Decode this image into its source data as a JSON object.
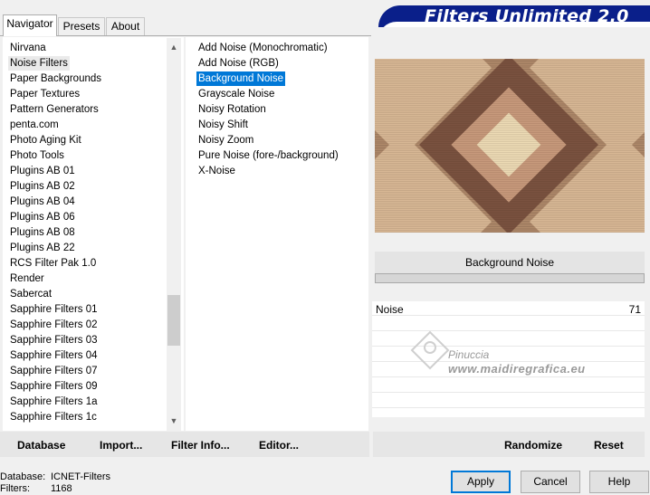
{
  "window": {
    "banner_title": "Filters Unlimited 2.0"
  },
  "tabs": [
    {
      "label": "Navigator",
      "active": true
    },
    {
      "label": "Presets",
      "active": false
    },
    {
      "label": "About",
      "active": false
    }
  ],
  "categories": [
    "Nirvana",
    "Noise Filters",
    "Paper Backgrounds",
    "Paper Textures",
    "Pattern Generators",
    "penta.com",
    "Photo Aging Kit",
    "Photo Tools",
    "Plugins AB 01",
    "Plugins AB 02",
    "Plugins AB 04",
    "Plugins AB 06",
    "Plugins AB 08",
    "Plugins AB 22",
    "RCS Filter Pak 1.0",
    "Render",
    "Sabercat",
    "Sapphire Filters 01",
    "Sapphire Filters 02",
    "Sapphire Filters 03",
    "Sapphire Filters 04",
    "Sapphire Filters 07",
    "Sapphire Filters 09",
    "Sapphire Filters 1a",
    "Sapphire Filters 1c"
  ],
  "selected_category": "Noise Filters",
  "filters": [
    "Add Noise (Monochromatic)",
    "Add Noise (RGB)",
    "Background Noise",
    "Grayscale Noise",
    "Noisy Rotation",
    "Noisy Shift",
    "Noisy Zoom",
    "Pure Noise (fore-/background)",
    "X-Noise"
  ],
  "selected_filter": "Background Noise",
  "preview": {
    "filter_name": "Background Noise"
  },
  "parameters": [
    {
      "label": "Noise",
      "value": "71"
    }
  ],
  "watermark": {
    "line1": "Pinuccia",
    "line2": "www.maidiregrafica.eu"
  },
  "actions": {
    "database": "Database",
    "import": "Import...",
    "filter_info": "Filter Info...",
    "editor": "Editor...",
    "randomize": "Randomize",
    "reset": "Reset"
  },
  "status": {
    "database_label": "Database:",
    "database_value": "ICNET-Filters",
    "filters_label": "Filters:",
    "filters_value": "1168"
  },
  "buttons": {
    "apply": "Apply",
    "cancel": "Cancel",
    "help": "Help"
  },
  "colors": {
    "banner": "#0a1f8a",
    "selection": "#0078d7"
  }
}
